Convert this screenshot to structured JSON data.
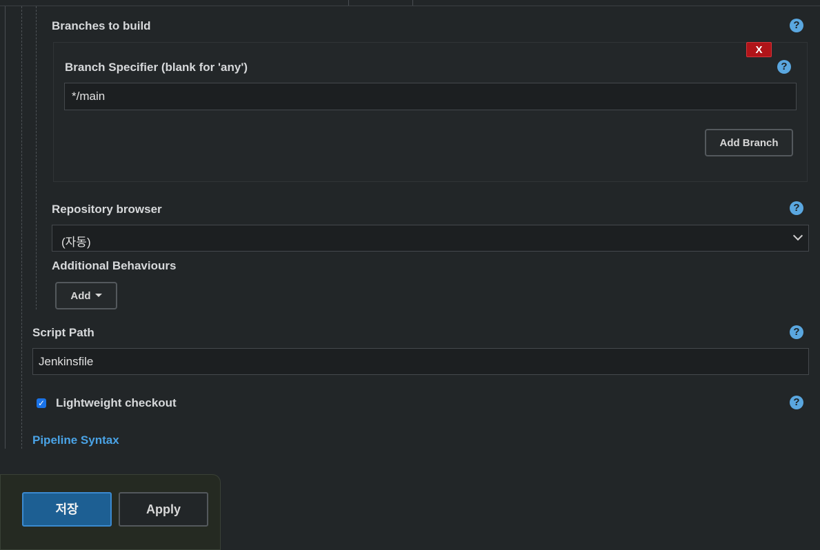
{
  "branches": {
    "section_label": "Branches to build",
    "help_icon": "question-circle-icon",
    "specifier_label": "Branch Specifier (blank for 'any')",
    "specifier_value": "*/main",
    "delete_label": "X",
    "add_branch_label": "Add Branch"
  },
  "repository_browser": {
    "label": "Repository browser",
    "selected": "(자동)"
  },
  "additional_behaviours": {
    "label": "Additional Behaviours",
    "add_label": "Add"
  },
  "script_path": {
    "label": "Script Path",
    "value": "Jenkinsfile"
  },
  "lightweight": {
    "label": "Lightweight checkout",
    "checked": true,
    "check_glyph": "✓"
  },
  "pipeline_syntax_label": "Pipeline Syntax",
  "help_glyph": "?",
  "footer": {
    "save_label": "저장",
    "apply_label": "Apply"
  },
  "colors": {
    "background": "#222628",
    "accent": "#5aa7e0",
    "danger": "#b01419",
    "primary": "#1d5f93"
  }
}
